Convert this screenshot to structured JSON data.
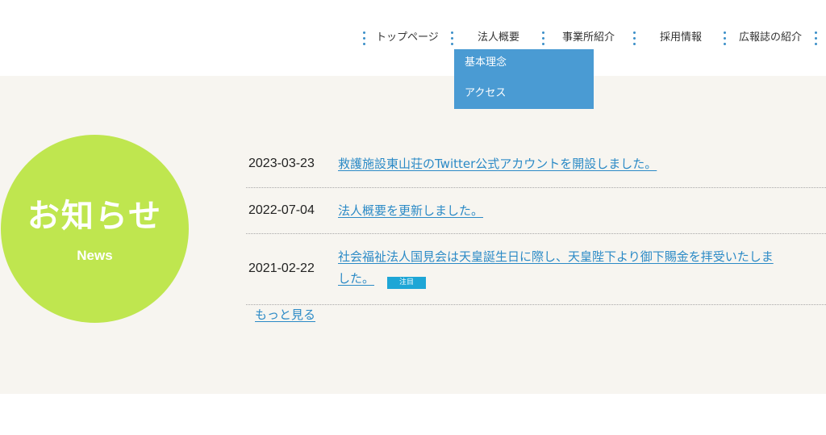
{
  "nav": {
    "items": [
      {
        "label": "トップページ"
      },
      {
        "label": "法人概要"
      },
      {
        "label": "事業所紹介"
      },
      {
        "label": "採用情報"
      },
      {
        "label": "広報誌の紹介"
      }
    ],
    "dropdown": [
      {
        "label": "基本理念"
      },
      {
        "label": "アクセス"
      }
    ],
    "accent_color": "#4a9bd3"
  },
  "news": {
    "title": "お知らせ",
    "subtitle": "News",
    "circle_color": "#bfe64f",
    "items": [
      {
        "date": "2023-03-23",
        "text": "救護施設東山荘のTwitter公式アカウントを開設しました。"
      },
      {
        "date": "2022-07-04",
        "text": "法人概要を更新しました。"
      },
      {
        "date": "2021-02-22",
        "text_line1": "社会福祉法人国見会は天皇誕生日に際し、天皇陛下より御下賜金を拝受いたしま",
        "text_line2": "した。",
        "badge": "注目"
      }
    ],
    "more": "もっと見る"
  }
}
